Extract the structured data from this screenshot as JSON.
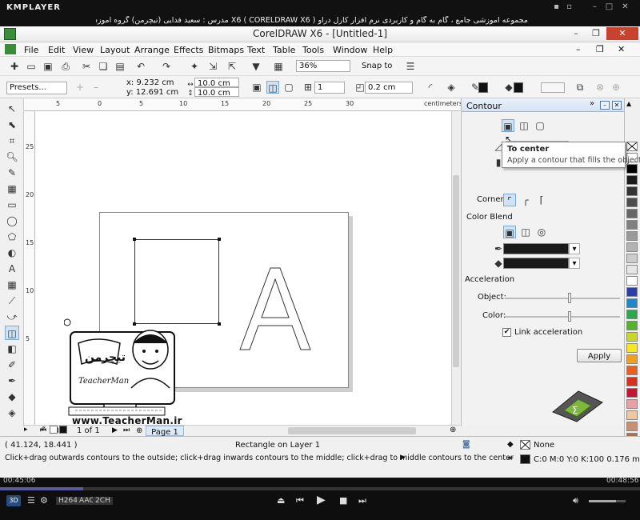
{
  "player": {
    "logo": "KMPLAYER",
    "title": "مجموعه آموزشی جامع ، گام به گام و کاربردی نرم افزار کارل دراو X6 ( CORELDRAW X6 ) مدرس : سعید فدایی (تیچرمن) گروه آموزشی پادشاه گرافیست ها",
    "time_elapsed": "00:45:06",
    "time_total": "00:48:56",
    "progress": 0.13,
    "codec_badges": [
      "H264",
      "AAC",
      "2CH"
    ],
    "badge_3d": "3D"
  },
  "app": {
    "title": "CorelDRAW X6 - [Untitled-1]",
    "menu": [
      "File",
      "Edit",
      "View",
      "Layout",
      "Arrange",
      "Effects",
      "Bitmaps",
      "Text",
      "Table",
      "Tools",
      "Window",
      "Help"
    ]
  },
  "toolbar": {
    "zoom": "36%",
    "snap_to": "Snap to"
  },
  "propbar": {
    "presets": "Presets...",
    "x": "x: 9.232 cm",
    "y": "y: 12.691 cm",
    "w": "10.0 cm",
    "h": "10.0 cm",
    "steps": "1",
    "offset": "0.2 cm"
  },
  "ruler": {
    "h_ticks": [
      "5",
      "0",
      "5",
      "10",
      "15",
      "20",
      "25",
      "30"
    ],
    "v_ticks": [
      "25",
      "20",
      "15",
      "10",
      "5"
    ],
    "unit": "centimeters"
  },
  "canvas": {
    "letter": "A",
    "watermark_url": "www.TeacherMan.ir",
    "watermark_brand": "TeacherMan"
  },
  "page_nav": {
    "count": "1 of 1",
    "tab": "Page 1"
  },
  "docker": {
    "title": "Contour",
    "corner_label": "Corner:",
    "color_blend": "Color Blend",
    "acceleration": "Acceleration",
    "object_label": "Object:",
    "color_label": "Color:",
    "link_accel": "Link acceleration",
    "apply": "Apply",
    "object_accel": 0.55,
    "color_accel": 0.55
  },
  "tooltip": {
    "title": "To center",
    "text": "Apply a contour that fills the object."
  },
  "status": {
    "coords": "( 41.124, 18.441 )",
    "object_info": "Rectangle on Layer 1",
    "hint": "Click+drag outwards contours to the outside; click+drag inwards contours to the middle; click+drag to middle contours to the center",
    "fill": "None",
    "outline": "C:0 M:0 Y:0 K:100  0.176 mm"
  },
  "colors": {
    "accent": "#cfe3f7",
    "palette": [
      "#ffffff",
      "#000000",
      "#1a1a1a",
      "#333333",
      "#4d4d4d",
      "#666666",
      "#808080",
      "#999999",
      "#b3b3b3",
      "#cccccc",
      "#e6e6e6",
      "#ffffff",
      "#2a3fa8",
      "#1e88c8",
      "#2aa84a",
      "#58b030",
      "#c8d828",
      "#f5e820",
      "#f0a020",
      "#e86020",
      "#d83020",
      "#c01830",
      "#e8a0a0",
      "#f0c8a0",
      "#c89070",
      "#a87050"
    ]
  }
}
